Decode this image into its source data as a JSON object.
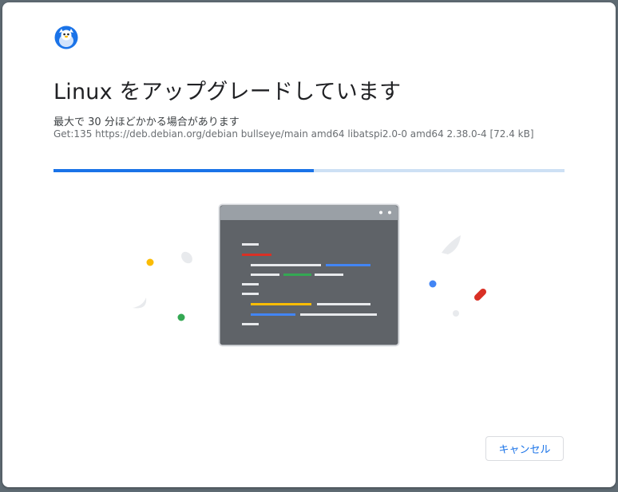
{
  "dialog": {
    "title": "Linux をアップグレードしています",
    "subtitle": "最大で 30 分ほどかかる場合があります",
    "status": "Get:135 https://deb.debian.org/debian bullseye/main amd64 libatspi2.0-0 amd64 2.38.0-4 [72.4 kB]",
    "progress_percent": 51,
    "cancel_label": "キャンセル",
    "app_icon": "linux-penguin-icon"
  },
  "colors": {
    "accent": "#1a73e8",
    "progress_track": "#cde0f4",
    "code_red": "#d93025",
    "code_green": "#34a853",
    "code_yellow": "#fbbc04",
    "code_blue": "#4285f4",
    "terminal_bg": "#5f6368"
  }
}
